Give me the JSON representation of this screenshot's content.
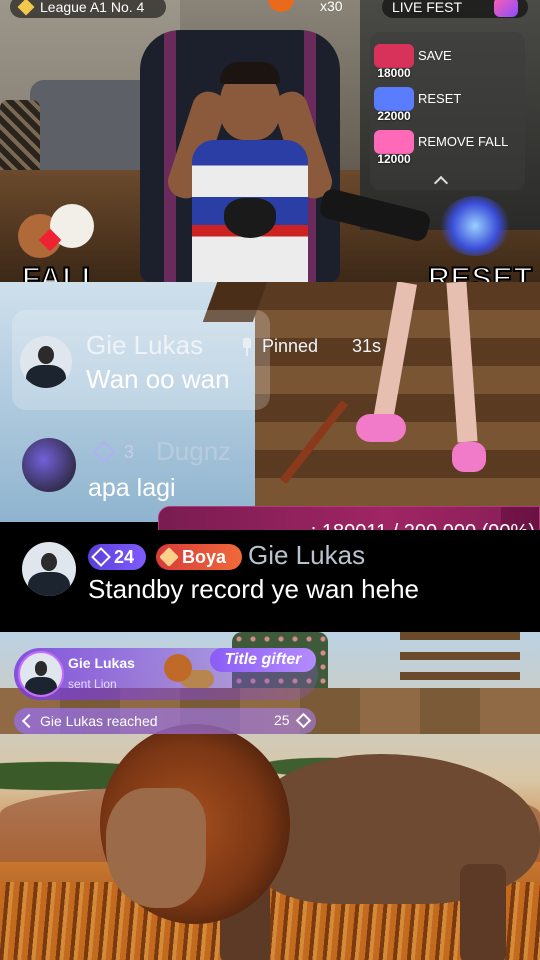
{
  "stream_hud": {
    "league": "League A1 No. 4",
    "multiplier": "x30",
    "event": "LIVE FEST"
  },
  "actions": [
    {
      "label": "SAVE",
      "cost": "18000",
      "thumb_color": "#d9325a"
    },
    {
      "label": "RESET",
      "cost": "22000",
      "thumb_color": "#5a7cff"
    },
    {
      "label": "REMOVE FALL",
      "cost": "12000",
      "thumb_color": "#ff6ab8"
    }
  ],
  "overlay_labels": {
    "left": "FALL",
    "right": "RESET"
  },
  "pinned": {
    "user": "Gie Lukas",
    "tag": "Pinned",
    "time": "31s",
    "text": "Wan oo wan"
  },
  "dugnz": {
    "level": "3",
    "user": "Dugnz",
    "text": "apa lagi"
  },
  "progress": {
    "text": ": 180011 / 200,000 (90%)",
    "fraction": 0.9
  },
  "latest_message": {
    "level": "24",
    "fan_badge": "Boya",
    "user": "Gie Lukas",
    "text": "Standby record ye wan hehe"
  },
  "gift": {
    "sender": "Gie Lukas",
    "action": "sent Lion",
    "title": "Title gifter",
    "reach_text": "Gie Lukas reached",
    "reach_level": "25"
  },
  "colors": {
    "accent_purple": "#7f5cff",
    "progress_magenta": "#8b1a55",
    "fan_red": "#d83a3a"
  }
}
